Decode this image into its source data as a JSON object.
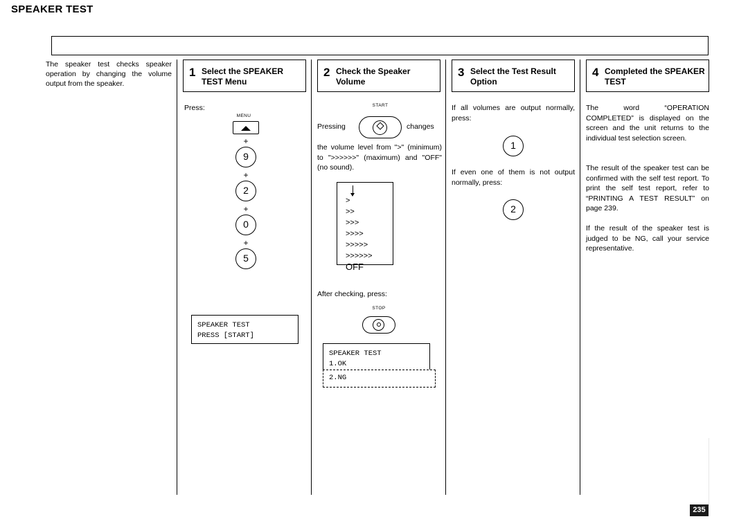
{
  "page": {
    "title": "SPEAKER TEST",
    "number": "235"
  },
  "intro": "The speaker test checks speaker operation by changing the volume output from the speaker.",
  "steps": [
    {
      "num": "1",
      "title": "Select the SPEAKER TEST Menu"
    },
    {
      "num": "2",
      "title": "Check the Speaker Volume"
    },
    {
      "num": "3",
      "title": "Select the Test Result Option"
    },
    {
      "num": "4",
      "title": "Completed the SPEAKER TEST"
    }
  ],
  "col1": {
    "press_label": "Press:",
    "menu_key_label": "MENU",
    "plus": "+",
    "keys": [
      "9",
      "2",
      "0",
      "5"
    ],
    "lcd": "SPEAKER TEST\nPRESS [START]"
  },
  "col2": {
    "start_key_label": "START",
    "pressing_label": "Pressing",
    "changes_label": "changes",
    "desc": "the volume level from \">\" (minimum) to \">>>>>>\" (maximum) and \"OFF\" (no sound).",
    "levels": [
      ">",
      ">>",
      ">>>",
      ">>>>",
      ">>>>>",
      ">>>>>>",
      "OFF"
    ],
    "after_label": "After checking, press:",
    "stop_key_label": "STOP",
    "lcd_solid": "SPEAKER TEST\n1.OK",
    "lcd_dashed": "2.NG"
  },
  "col3": {
    "para1": "If all volumes are output normally, press:",
    "key1": "1",
    "para2": "If even one of them is not output normally, press:",
    "key2": "2"
  },
  "col4": {
    "para1": "The word “OPERATION COMPLETED” is displayed on the screen and the unit returns to the individual test selection screen.",
    "para2": "The result of the speaker test can be confirmed with the self test report. To print the self test report, refer to “PRINTING A TEST RESULT” on page 239.",
    "para3": "If the result of the speaker test is judged to be NG, call your service representative."
  }
}
